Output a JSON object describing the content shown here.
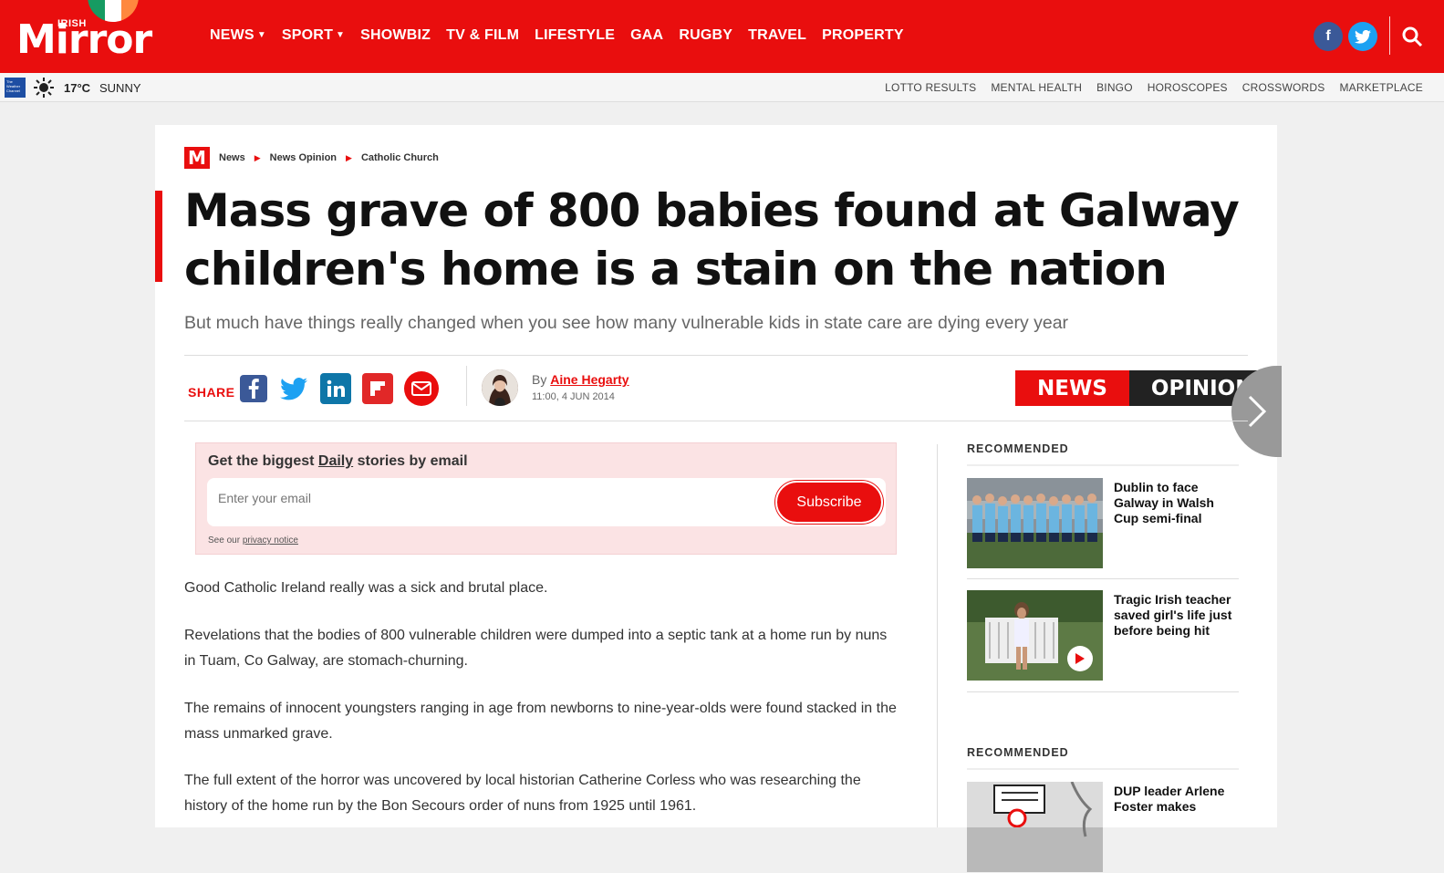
{
  "header": {
    "logo_small": "IRISH",
    "logo_main": "Mirror",
    "nav": [
      {
        "label": "NEWS",
        "dropdown": true
      },
      {
        "label": "SPORT",
        "dropdown": true
      },
      {
        "label": "SHOWBIZ",
        "dropdown": false
      },
      {
        "label": "TV & FILM",
        "dropdown": false
      },
      {
        "label": "LIFESTYLE",
        "dropdown": false
      },
      {
        "label": "GAA",
        "dropdown": false
      },
      {
        "label": "RUGBY",
        "dropdown": false
      },
      {
        "label": "TRAVEL",
        "dropdown": false
      },
      {
        "label": "PROPERTY",
        "dropdown": false
      }
    ],
    "facebook_glyph": "f",
    "colors": {
      "brand": "#e90e0e",
      "facebook": "#3b5998",
      "twitter": "#1da1f2"
    }
  },
  "subbar": {
    "weather_logo": "The Weather Channel",
    "temp": "17°C",
    "condition": "SUNNY",
    "links": [
      "LOTTO RESULTS",
      "MENTAL HEALTH",
      "BINGO",
      "HOROSCOPES",
      "CROSSWORDS",
      "MARKETPLACE"
    ]
  },
  "breadcrumb": {
    "badge": "M",
    "items": [
      "News",
      "News Opinion",
      "Catholic Church"
    ]
  },
  "article": {
    "headline": "Mass grave of 800 babies found at Galway children's home is a stain on the nation",
    "standfirst": "But much have things really changed when you see how many vulnerable kids in state care are dying every year",
    "share_label": "SHARE",
    "share_icons": [
      "facebook-icon",
      "twitter-icon",
      "linkedin-icon",
      "flipboard-icon",
      "email-icon"
    ],
    "by_prefix": "By",
    "author": "Aine Hegarty",
    "timestamp": "11:00, 4 JUN 2014",
    "tag_left": "NEWS",
    "tag_right": "OPINION",
    "paragraphs": [
      "Good Catholic Ireland really was a sick and brutal place.",
      "Revelations that the bodies of 800 vulnerable children were dumped into a septic tank at a home run by nuns in Tuam, Co Galway, are stomach-churning.",
      "The remains of innocent youngsters ranging in age from newborns to nine-year-olds were found stacked in the mass unmarked grave.",
      "The full extent of the horror was uncovered by local historian Catherine Corless who was researching the history of the home run by the Bon Secours order of nuns from 1925 until 1961."
    ]
  },
  "newsletter": {
    "title_pre": "Get the biggest ",
    "title_em": "Daily",
    "title_post": " stories by email",
    "placeholder": "Enter your email",
    "button": "Subscribe",
    "privacy_pre": "See our ",
    "privacy_link": "privacy notice"
  },
  "sidebar": {
    "rec_heading_1": "RECOMMENDED",
    "items_1": [
      {
        "title": "Dublin to face Galway in Walsh Cup semi-final",
        "video": false
      },
      {
        "title": "Tragic Irish teacher saved girl's life just before being hit",
        "video": true
      }
    ],
    "rec_heading_2": "RECOMMENDED",
    "items_2": [
      {
        "title": "DUP leader Arlene Foster makes",
        "video": false
      }
    ]
  }
}
